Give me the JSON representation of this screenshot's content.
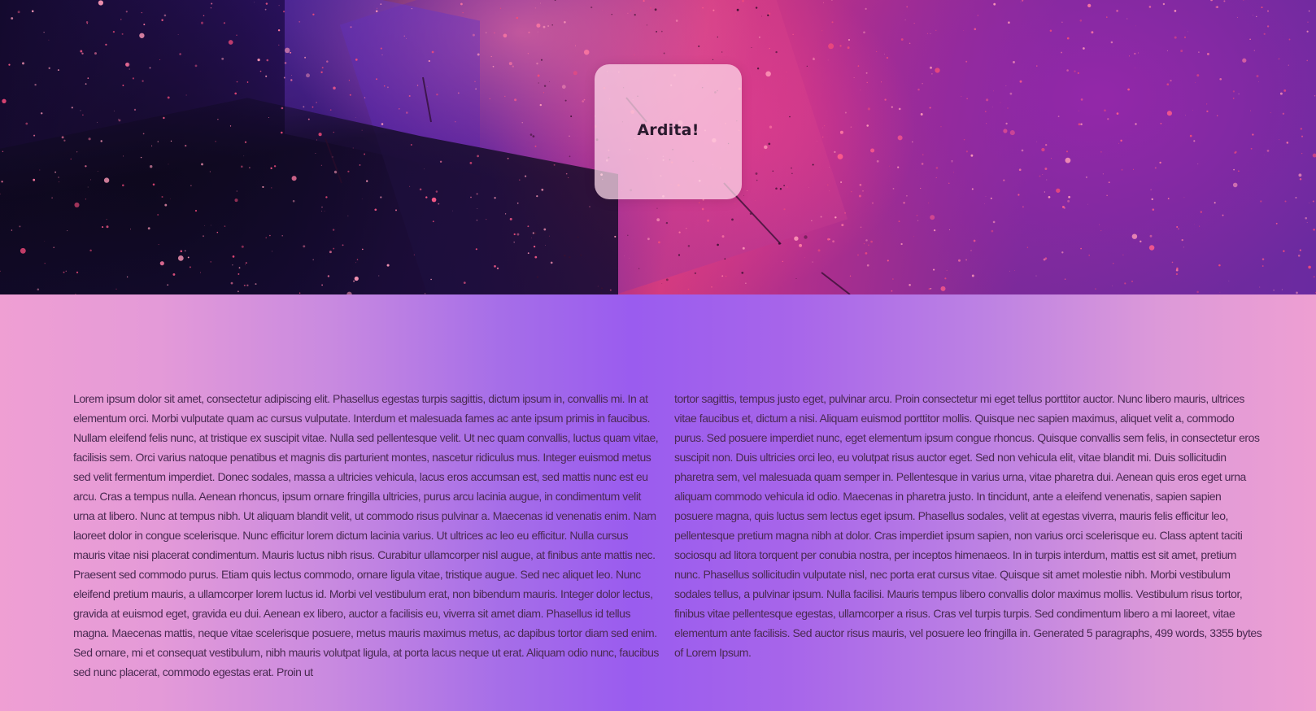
{
  "hero": {
    "brand": "Ardita!"
  },
  "content": {
    "column_left": "Lorem ipsum dolor sit amet, consectetur adipiscing elit. Phasellus egestas turpis sagittis, dictum ipsum in, convallis mi. In at elementum orci. Morbi vulputate quam ac cursus vulputate. Interdum et malesuada fames ac ante ipsum primis in faucibus. Nullam eleifend felis nunc, at tristique ex suscipit vitae. Nulla sed pellentesque velit. Ut nec quam convallis, luctus quam vitae, facilisis sem. Orci varius natoque penatibus et magnis dis parturient montes, nascetur ridiculus mus. Integer euismod metus sed velit fermentum imperdiet. Donec sodales, massa a ultricies vehicula, lacus eros accumsan est, sed mattis nunc est eu arcu. Cras a tempus nulla. Aenean rhoncus, ipsum ornare fringilla ultricies, purus arcu lacinia augue, in condimentum velit urna at libero. Nunc at tempus nibh. Ut aliquam blandit velit, ut commodo risus pulvinar a. Maecenas id venenatis enim. Nam laoreet dolor in congue scelerisque. Nunc efficitur lorem dictum lacinia varius. Ut ultrices ac leo eu efficitur. Nulla cursus mauris vitae nisi placerat condimentum. Mauris luctus nibh risus. Curabitur ullamcorper nisl augue, at finibus ante mattis nec. Praesent sed commodo purus. Etiam quis lectus commodo, ornare ligula vitae, tristique augue. Sed nec aliquet leo. Nunc eleifend pretium mauris, a ullamcorper lorem luctus id. Morbi vel vestibulum erat, non bibendum mauris. Integer dolor lectus, gravida at euismod eget, gravida eu dui. Aenean ex libero, auctor a facilisis eu, viverra sit amet diam. Phasellus id tellus magna. Maecenas mattis, neque vitae scelerisque posuere, metus mauris maximus metus, ac dapibus tortor diam sed enim. Sed ornare, mi et consequat vestibulum, nibh mauris volutpat ligula, at porta lacus neque ut erat. Aliquam odio nunc, faucibus sed nunc placerat, commodo egestas erat. Proin ut",
    "column_right": "tortor sagittis, tempus justo eget, pulvinar arcu. Proin consectetur mi eget tellus porttitor auctor. Nunc libero mauris, ultrices vitae faucibus et, dictum a nisi. Aliquam euismod porttitor mollis. Quisque nec sapien maximus, aliquet velit a, commodo purus. Sed posuere imperdiet nunc, eget elementum ipsum congue rhoncus. Quisque convallis sem felis, in consectetur eros suscipit non. Duis ultricies orci leo, eu volutpat risus auctor eget. Sed non vehicula elit, vitae blandit mi. Duis sollicitudin pharetra sem, vel malesuada quam semper in. Pellentesque in varius urna, vitae pharetra dui. Aenean quis eros eget urna aliquam commodo vehicula id odio. Maecenas in pharetra justo. In tincidunt, ante a eleifend venenatis, sapien sapien posuere magna, quis luctus sem lectus eget ipsum. Phasellus sodales, velit at egestas viverra, mauris felis efficitur leo, pellentesque pretium magna nibh at dolor. Cras imperdiet ipsum sapien, non varius orci scelerisque eu. Class aptent taciti sociosqu ad litora torquent per conubia nostra, per inceptos himenaeos. In in turpis interdum, mattis est sit amet, pretium nunc. Phasellus sollicitudin vulputate nisl, nec porta erat cursus vitae. Quisque sit amet molestie nibh. Morbi vestibulum sodales tellus, a pulvinar ipsum. Nulla facilisi. Mauris tempus libero convallis dolor maximus mollis. Vestibulum risus tortor, finibus vitae pellentesque egestas, ullamcorper a risus. Cras vel turpis turpis. Sed condimentum libero a mi laoreet, vitae elementum ante facilisis. Sed auctor risus mauris, vel posuere leo fringilla in. Generated 5 paragraphs, 499 words, 3355 bytes of Lorem Ipsum."
  }
}
